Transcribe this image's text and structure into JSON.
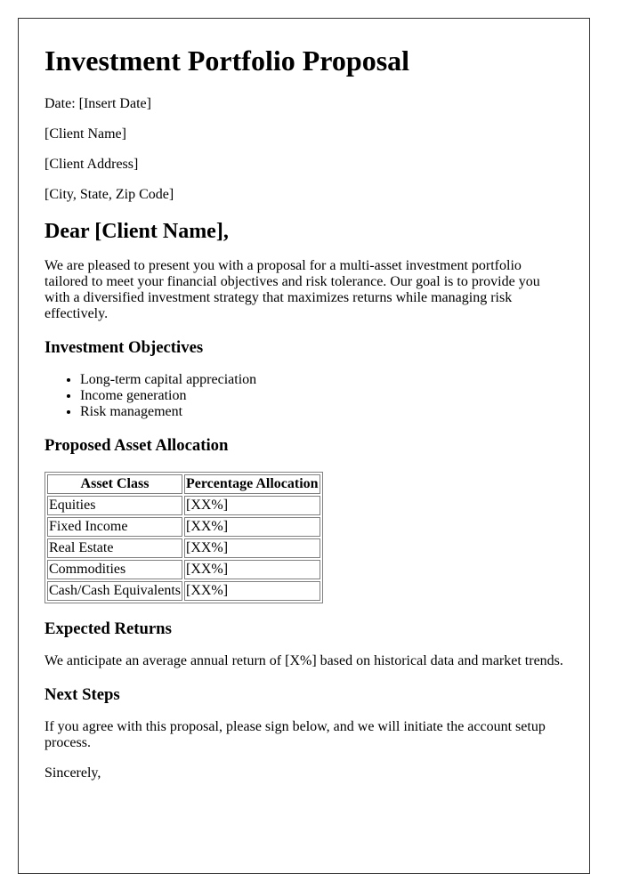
{
  "title": "Investment Portfolio Proposal",
  "header_lines": [
    "Date: [Insert Date]",
    "[Client Name]",
    "[Client Address]",
    "[City, State, Zip Code]"
  ],
  "salutation": "Dear [Client Name],",
  "intro": "We are pleased to present you with a proposal for a multi-asset investment portfolio tailored to meet your financial objectives and risk tolerance. Our goal is to provide you with a diversified investment strategy that maximizes returns while managing risk effectively.",
  "objectives": {
    "heading": "Investment Objectives",
    "items": [
      "Long-term capital appreciation",
      "Income generation",
      "Risk management"
    ]
  },
  "allocation": {
    "heading": "Proposed Asset Allocation",
    "columns": [
      "Asset Class",
      "Percentage Allocation"
    ],
    "rows": [
      [
        "Equities",
        "[XX%]"
      ],
      [
        "Fixed Income",
        "[XX%]"
      ],
      [
        "Real Estate",
        "[XX%]"
      ],
      [
        "Commodities",
        "[XX%]"
      ],
      [
        "Cash/Cash Equivalents",
        "[XX%]"
      ]
    ]
  },
  "returns": {
    "heading": "Expected Returns",
    "text": "We anticipate an average annual return of [X%] based on historical data and market trends."
  },
  "next_steps": {
    "heading": "Next Steps",
    "text": "If you agree with this proposal, please sign below, and we will initiate the account setup process."
  },
  "closing": "Sincerely,"
}
